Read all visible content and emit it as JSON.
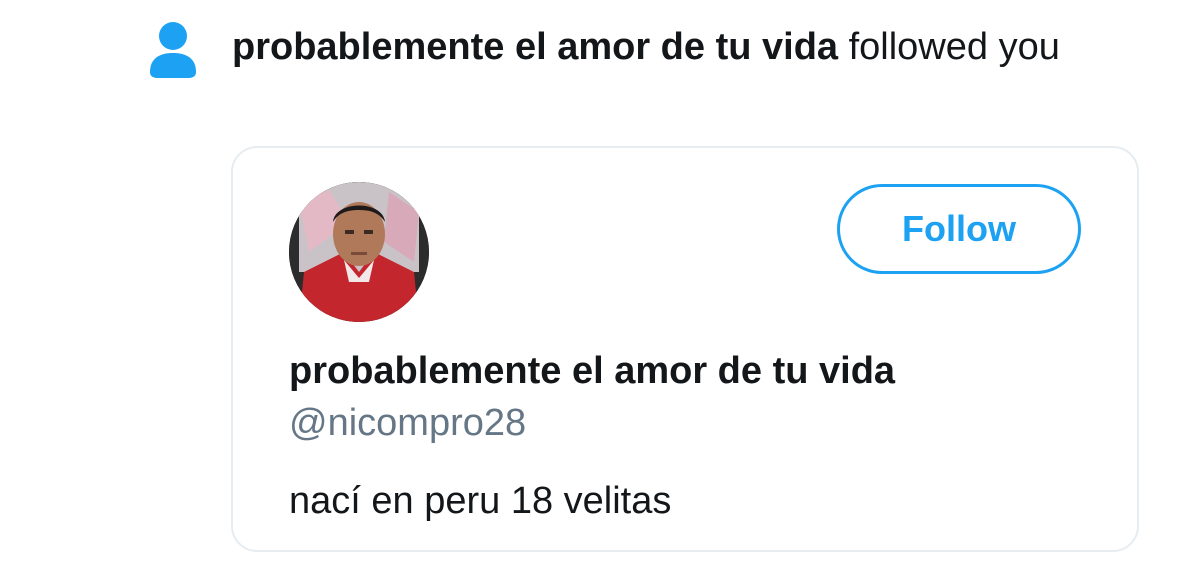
{
  "notification": {
    "icon": "person-icon",
    "name": "probablemente el amor de tu vida",
    "action": "followed you"
  },
  "card": {
    "avatar": "profile-photo",
    "follow_label": "Follow",
    "display_name": "probablemente el amor de tu vida",
    "handle": "@nicompro28",
    "bio": "nací en peru 18 velitas"
  },
  "colors": {
    "accent": "#1da1f2",
    "text": "#14171a",
    "secondary_text": "#657786",
    "border": "#e6ecf0"
  }
}
